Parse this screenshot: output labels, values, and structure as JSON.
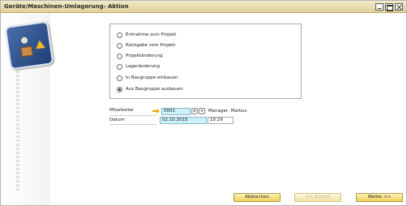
{
  "window": {
    "title": "Geräte/Maschinen-Umlagerung- Aktion"
  },
  "options": [
    {
      "label": "Entnahme zum Projekt",
      "checked": false
    },
    {
      "label": "Rückgabe vom Projekt",
      "checked": false
    },
    {
      "label": "Projektänderung",
      "checked": false
    },
    {
      "label": "Lageränderung",
      "checked": false
    },
    {
      "label": "In Baugruppe einbauen",
      "checked": false
    },
    {
      "label": "Aus Baugruppe ausbauen",
      "checked": true
    }
  ],
  "fields": {
    "mitarbeiter_label": "Mitarbeiter",
    "mitarbeiter_code": "0001",
    "mitarbeiter_name": "Manager, Markus",
    "datum_label": "Datum",
    "datum_value": "02.10.2015",
    "zeit_value": "10:29"
  },
  "buttons": {
    "cancel": "Abbrechen",
    "back": "<< Zurück",
    "next": "Weiter >>"
  },
  "colors": {
    "titlebar": "#e8dcaa",
    "button": "#f0cf5a",
    "highlight_input": "#c9f2fb"
  }
}
